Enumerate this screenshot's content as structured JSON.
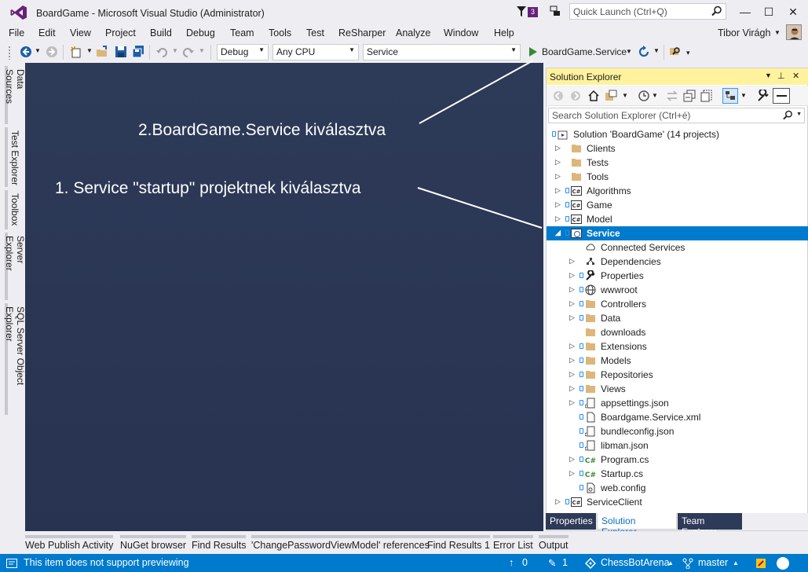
{
  "window": {
    "title": "BoardGame - Microsoft Visual Studio  (Administrator)",
    "notification_count": "3",
    "quick_launch_placeholder": "Quick Launch (Ctrl+Q)",
    "minimize": "—",
    "maximize": "☐",
    "close": "✕"
  },
  "menu": {
    "items": [
      "File",
      "Edit",
      "View",
      "Project",
      "Build",
      "Debug",
      "Team",
      "Tools",
      "Test",
      "ReSharper",
      "Analyze",
      "Window",
      "Help"
    ],
    "user": "Tibor Virágh"
  },
  "toolbar": {
    "configuration": "Debug",
    "platform": "Any CPU",
    "startup_project": "Service",
    "run_target": "BoardGame.Service"
  },
  "side_tabs": [
    "Data Sources",
    "Test Explorer",
    "Toolbox",
    "Server Explorer",
    "SQL Server Object Explorer"
  ],
  "annotations": {
    "step2": "2.BoardGame.Service kiválasztva",
    "step1": "1. Service \"startup\" projektnek kiválasztva"
  },
  "solution_explorer": {
    "title": "Solution Explorer",
    "search_placeholder": "Search Solution Explorer (Ctrl+é)",
    "solution_label": "Solution 'BoardGame' (14 projects)",
    "nodes": [
      {
        "label": "Clients",
        "kind": "folder"
      },
      {
        "label": "Tests",
        "kind": "folder"
      },
      {
        "label": "Tools",
        "kind": "folder"
      },
      {
        "label": "Algorithms",
        "kind": "csproj"
      },
      {
        "label": "Game",
        "kind": "csproj"
      },
      {
        "label": "Model",
        "kind": "csproj"
      },
      {
        "label": "Service",
        "kind": "webproj"
      },
      {
        "label": "Connected Services",
        "kind": "cloud"
      },
      {
        "label": "Dependencies",
        "kind": "deps"
      },
      {
        "label": "Properties",
        "kind": "wrench"
      },
      {
        "label": "wwwroot",
        "kind": "globe"
      },
      {
        "label": "Controllers",
        "kind": "folder"
      },
      {
        "label": "Data",
        "kind": "folder"
      },
      {
        "label": "downloads",
        "kind": "folder"
      },
      {
        "label": "Extensions",
        "kind": "folder"
      },
      {
        "label": "Models",
        "kind": "folder"
      },
      {
        "label": "Repositories",
        "kind": "folder"
      },
      {
        "label": "Views",
        "kind": "folder"
      },
      {
        "label": "appsettings.json",
        "kind": "json"
      },
      {
        "label": "Boardgame.Service.xml",
        "kind": "file"
      },
      {
        "label": "bundleconfig.json",
        "kind": "json"
      },
      {
        "label": "libman.json",
        "kind": "json"
      },
      {
        "label": "Program.cs",
        "kind": "cs"
      },
      {
        "label": "Startup.cs",
        "kind": "cs"
      },
      {
        "label": "web.config",
        "kind": "config"
      },
      {
        "label": "ServiceClient",
        "kind": "csproj"
      }
    ],
    "tabs": [
      "Properties",
      "Solution Explorer",
      "Team Explorer"
    ]
  },
  "bottom_tabs": [
    "Web Publish Activity",
    "NuGet browser",
    "Find Results",
    "'ChangePasswordViewModel' references",
    "Find Results 1",
    "Error List",
    "Output"
  ],
  "status": {
    "message": "This item does not support previewing",
    "up_count": "0",
    "pending_count": "1",
    "repo": "ChessBotArena",
    "branch": "master"
  }
}
